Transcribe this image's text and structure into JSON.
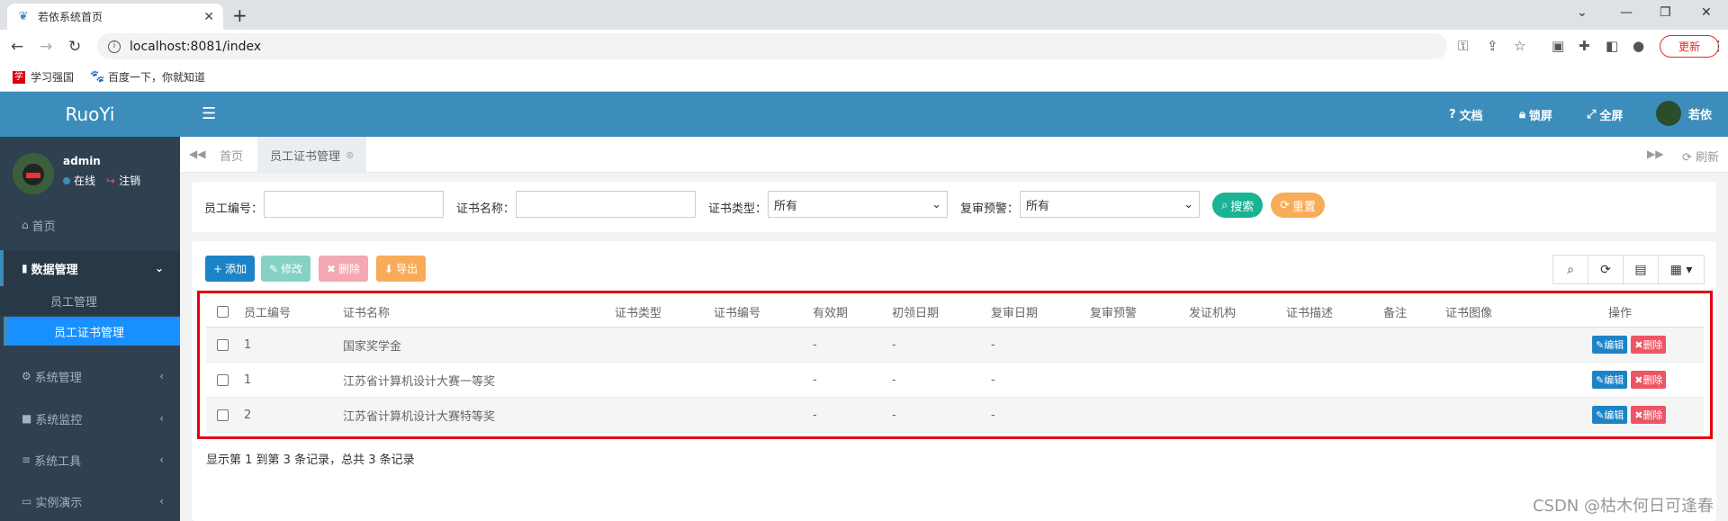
{
  "browser": {
    "tab_title": "若依系统首页",
    "url": "localhost:8081/index",
    "update_label": "更新",
    "bookmarks": [
      {
        "label": "学习强国",
        "color": "#d6000f"
      },
      {
        "label": "百度一下，你就知道",
        "color": "#2932e1"
      }
    ]
  },
  "app": {
    "logo": "RuoYi",
    "header": {
      "docs": "文档",
      "lock": "锁屏",
      "fullscreen": "全屏",
      "user": "若依"
    },
    "user_panel": {
      "name": "admin",
      "online": "在线",
      "logout": "注销"
    },
    "menu": {
      "home": "首页",
      "data_mgmt": "数据管理",
      "employee_mgmt": "员工管理",
      "cert_mgmt": "员工证书管理",
      "system_mgmt": "系统管理",
      "system_monitor": "系统监控",
      "system_tools": "系统工具",
      "demo": "实例演示"
    },
    "page_tabs": {
      "home": "首页",
      "current": "员工证书管理",
      "refresh": "刷新"
    },
    "search": {
      "employee_no_label": "员工编号：",
      "cert_name_label": "证书名称：",
      "cert_type_label": "证书类型：",
      "cert_type_value": "所有",
      "review_alert_label": "复审预警：",
      "review_alert_value": "所有",
      "search_btn": "搜索",
      "reset_btn": "重置"
    },
    "toolbar": {
      "add": "添加",
      "edit": "修改",
      "delete": "删除",
      "export": "导出"
    },
    "table": {
      "headers": [
        "员工编号",
        "证书名称",
        "证书类型",
        "证书编号",
        "有效期",
        "初领日期",
        "复审日期",
        "复审预警",
        "发证机构",
        "证书描述",
        "备注",
        "证书图像",
        "操作"
      ],
      "rows": [
        {
          "emp_no": "1",
          "cert_name": "国家奖学金",
          "validity": "-",
          "first_date": "-",
          "review_date": "-"
        },
        {
          "emp_no": "1",
          "cert_name": "江苏省计算机设计大赛一等奖",
          "validity": "-",
          "first_date": "-",
          "review_date": "-"
        },
        {
          "emp_no": "2",
          "cert_name": "江苏省计算机设计大赛特等奖",
          "validity": "-",
          "first_date": "-",
          "review_date": "-"
        }
      ],
      "edit_label": "编辑",
      "delete_label": "删除"
    },
    "pagination_text": "显示第 1 到第 3 条记录，总共 3 条记录"
  },
  "watermark": "CSDN @枯木何日可逢春",
  "colors": {
    "header": "#3c8dbc",
    "sidebar": "#2f4050",
    "active_menu": "#1890ff",
    "primary": "#1c84c6",
    "danger": "#ed5565",
    "success": "#1ab394",
    "warning": "#f8ac59",
    "highlight_border": "#e60012"
  }
}
